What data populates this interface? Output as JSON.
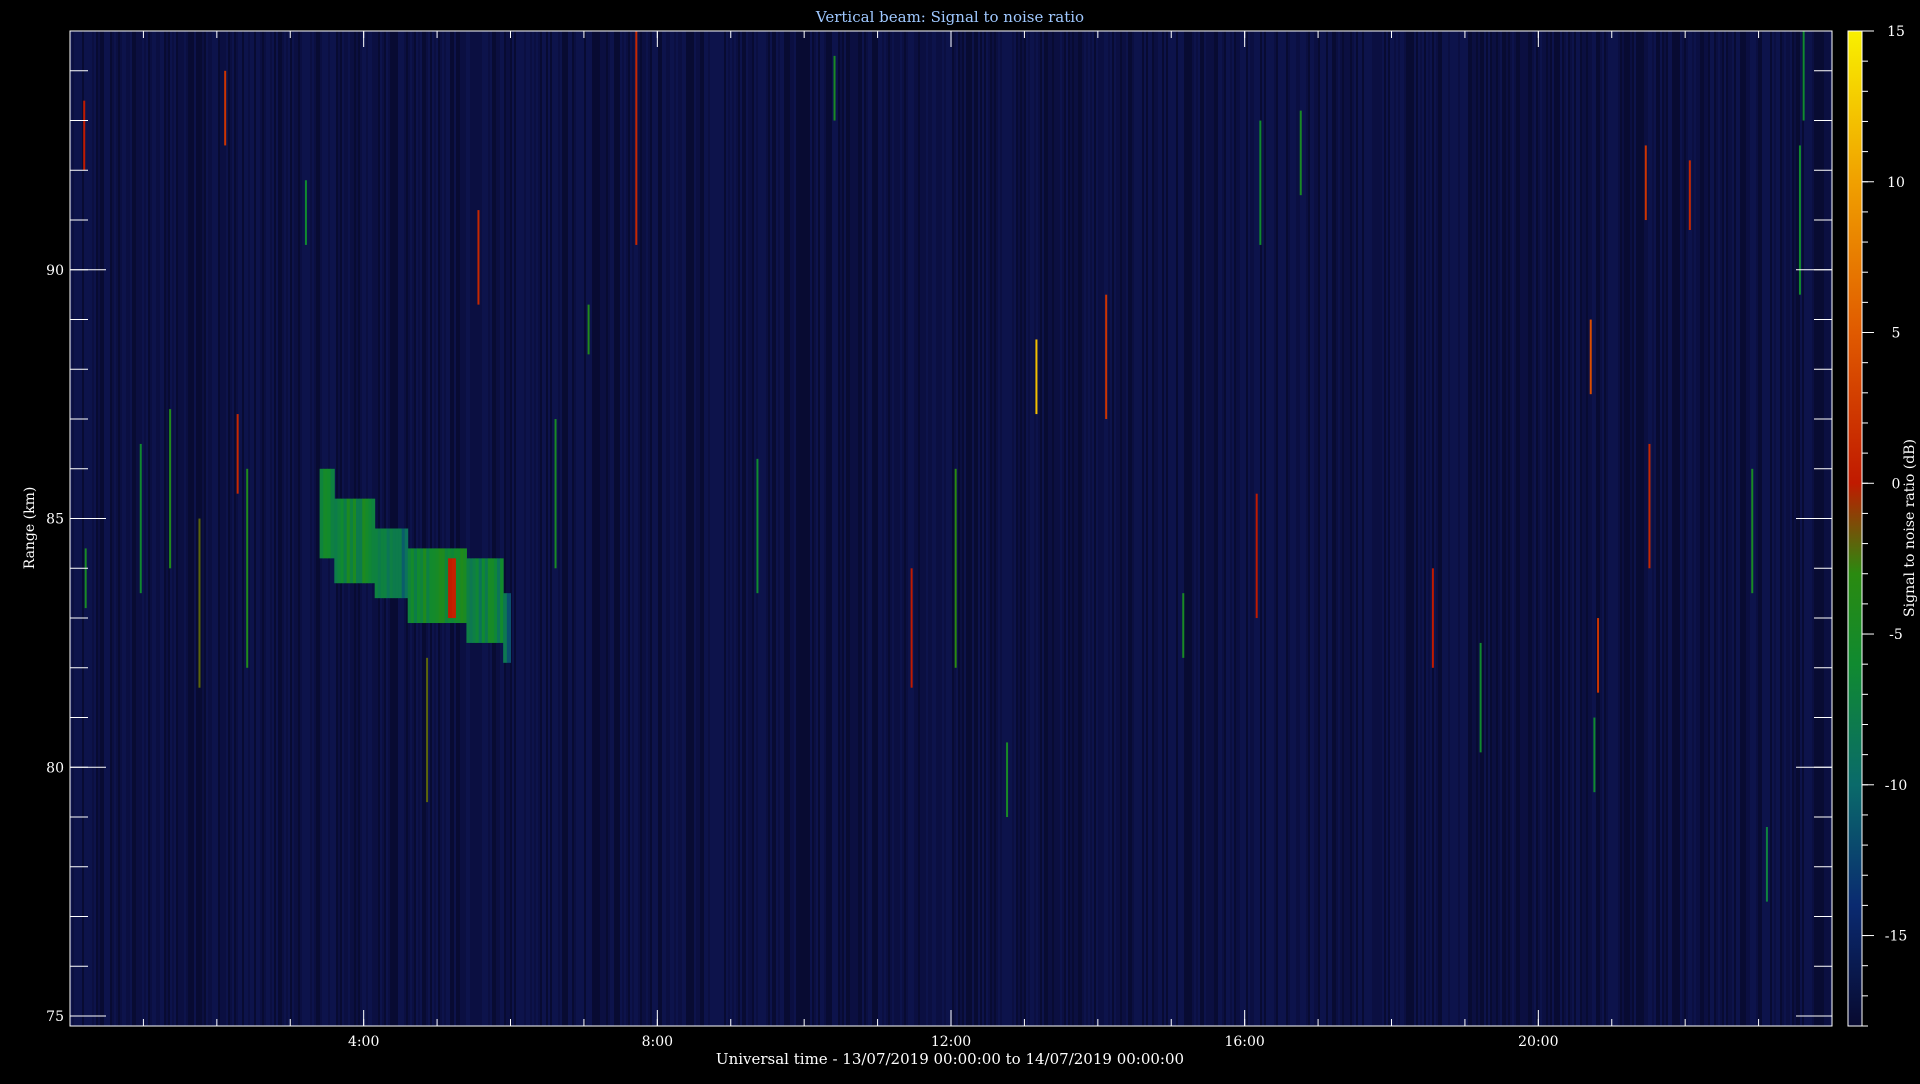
{
  "colors": {
    "background": "#000000",
    "plot_background": "#0a0d3a",
    "axis": "#ffffff",
    "title": "#9fc8ff",
    "text": "#ffffff"
  },
  "chart_data": {
    "type": "heatmap",
    "title": "Vertical beam: Signal to noise ratio",
    "xlabel": "Universal time - 13/07/2019 00:00:00 to 14/07/2019 00:00:00",
    "ylabel": "Range (km)",
    "x_unit": "hours UT",
    "xlim": [
      0,
      24
    ],
    "ylim": [
      74.8,
      94.8
    ],
    "x_major_ticks": [
      4,
      8,
      12,
      16,
      20
    ],
    "x_tick_labels": [
      "4:00",
      "8:00",
      "12:00",
      "16:00",
      "20:00"
    ],
    "x_minor_step": 1,
    "y_major_ticks": [
      75,
      80,
      85,
      90
    ],
    "y_tick_labels": [
      "75",
      "80",
      "85",
      "90"
    ],
    "y_minor_step": 1,
    "colorbar": {
      "label": "Signal to noise ratio (dB)",
      "range": [
        -18,
        15
      ],
      "ticks": [
        -15,
        -10,
        -5,
        0,
        5,
        10,
        15
      ],
      "tick_labels": [
        "-15",
        "-10",
        "-5",
        "0",
        "5",
        "10",
        "15"
      ],
      "colormap": [
        {
          "v": -18,
          "c": "#080a30"
        },
        {
          "v": -14,
          "c": "#0a2a70"
        },
        {
          "v": -10,
          "c": "#0a6a6a"
        },
        {
          "v": -6,
          "c": "#108a30"
        },
        {
          "v": -3,
          "c": "#2a8a10"
        },
        {
          "v": 0,
          "c": "#c01a00"
        },
        {
          "v": 5,
          "c": "#e05a00"
        },
        {
          "v": 10,
          "c": "#f0a000"
        },
        {
          "v": 15,
          "c": "#f8f000"
        }
      ]
    },
    "echo_regions": [
      {
        "x0": 3.4,
        "x1": 3.6,
        "y0": 84.2,
        "y1": 86.0,
        "snr": -6
      },
      {
        "x0": 3.6,
        "x1": 4.15,
        "y0": 83.7,
        "y1": 85.4,
        "snr": -6
      },
      {
        "x0": 4.15,
        "x1": 4.6,
        "y0": 83.4,
        "y1": 84.8,
        "snr": -9
      },
      {
        "x0": 4.6,
        "x1": 5.4,
        "y0": 82.9,
        "y1": 84.4,
        "snr": -6
      },
      {
        "x0": 5.4,
        "x1": 5.9,
        "y0": 82.5,
        "y1": 84.2,
        "snr": -7
      },
      {
        "x0": 5.9,
        "x1": 6.0,
        "y0": 82.1,
        "y1": 83.5,
        "snr": -10
      },
      {
        "x0": 5.15,
        "x1": 5.25,
        "y0": 83.0,
        "y1": 84.2,
        "snr": 0
      }
    ],
    "streaks": [
      {
        "x": 0.18,
        "y0": 92.0,
        "y1": 93.4,
        "snr": 0
      },
      {
        "x": 0.2,
        "y0": 83.2,
        "y1": 84.4,
        "snr": -5
      },
      {
        "x": 0.95,
        "y0": 83.5,
        "y1": 86.5,
        "snr": -6
      },
      {
        "x": 1.35,
        "y0": 84.0,
        "y1": 87.2,
        "snr": -4
      },
      {
        "x": 1.75,
        "y0": 81.6,
        "y1": 85.0,
        "snr": -2
      },
      {
        "x": 2.1,
        "y0": 92.5,
        "y1": 94.0,
        "snr": 2
      },
      {
        "x": 2.27,
        "y0": 85.5,
        "y1": 87.1,
        "snr": 1
      },
      {
        "x": 2.4,
        "y0": 82.0,
        "y1": 86.0,
        "snr": -4
      },
      {
        "x": 3.2,
        "y0": 90.5,
        "y1": 91.8,
        "snr": -6
      },
      {
        "x": 5.55,
        "y0": 89.3,
        "y1": 91.2,
        "snr": 1
      },
      {
        "x": 4.85,
        "y0": 79.3,
        "y1": 82.2,
        "snr": -2
      },
      {
        "x": 7.7,
        "y0": 90.5,
        "y1": 94.8,
        "snr": 1
      },
      {
        "x": 7.05,
        "y0": 88.3,
        "y1": 89.3,
        "snr": -4
      },
      {
        "x": 6.6,
        "y0": 84.0,
        "y1": 87.0,
        "snr": -5
      },
      {
        "x": 9.35,
        "y0": 83.5,
        "y1": 86.2,
        "snr": -6
      },
      {
        "x": 10.4,
        "y0": 93.0,
        "y1": 94.3,
        "snr": -5
      },
      {
        "x": 11.45,
        "y0": 81.6,
        "y1": 84.0,
        "snr": 0
      },
      {
        "x": 12.05,
        "y0": 82.0,
        "y1": 86.0,
        "snr": -3
      },
      {
        "x": 12.75,
        "y0": 79.0,
        "y1": 80.5,
        "snr": -5
      },
      {
        "x": 13.15,
        "y0": 87.1,
        "y1": 88.6,
        "snr": 12
      },
      {
        "x": 14.1,
        "y0": 87.0,
        "y1": 89.5,
        "snr": 2
      },
      {
        "x": 15.15,
        "y0": 82.2,
        "y1": 83.5,
        "snr": -5
      },
      {
        "x": 16.15,
        "y0": 83.0,
        "y1": 85.5,
        "snr": 0
      },
      {
        "x": 16.2,
        "y0": 90.5,
        "y1": 93.0,
        "snr": -6
      },
      {
        "x": 16.75,
        "y0": 91.5,
        "y1": 93.2,
        "snr": -5
      },
      {
        "x": 18.55,
        "y0": 82.0,
        "y1": 84.0,
        "snr": 0
      },
      {
        "x": 19.2,
        "y0": 80.3,
        "y1": 82.5,
        "snr": -6
      },
      {
        "x": 20.7,
        "y0": 87.5,
        "y1": 89.0,
        "snr": 4
      },
      {
        "x": 20.8,
        "y0": 81.5,
        "y1": 83.0,
        "snr": 2
      },
      {
        "x": 20.75,
        "y0": 79.5,
        "y1": 81.0,
        "snr": -6
      },
      {
        "x": 21.5,
        "y0": 84.0,
        "y1": 86.5,
        "snr": 1
      },
      {
        "x": 21.45,
        "y0": 91.0,
        "y1": 92.5,
        "snr": 2
      },
      {
        "x": 22.05,
        "y0": 90.8,
        "y1": 92.2,
        "snr": 1
      },
      {
        "x": 23.55,
        "y0": 89.5,
        "y1": 92.5,
        "snr": -6
      },
      {
        "x": 23.6,
        "y0": 93.0,
        "y1": 94.8,
        "snr": -6
      },
      {
        "x": 23.1,
        "y0": 77.3,
        "y1": 78.8,
        "snr": -7
      },
      {
        "x": 22.9,
        "y0": 83.5,
        "y1": 86.0,
        "snr": -5
      }
    ]
  }
}
